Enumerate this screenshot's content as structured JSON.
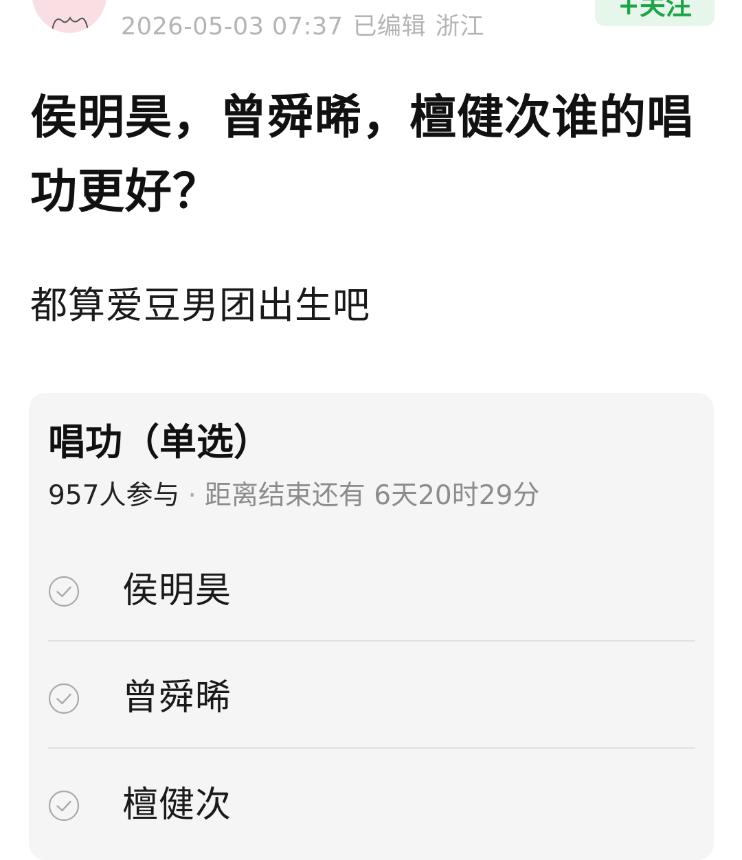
{
  "header": {
    "date": "2026-05-03 07:37",
    "edited": "已编辑",
    "location": "浙江",
    "follow_label": "+关注"
  },
  "post": {
    "title": "侯明昊，曾舜晞，檀健次谁的唱功更好？",
    "body": "都算爱豆男团出生吧"
  },
  "poll": {
    "title": "唱功（单选）",
    "participants": "957人参与",
    "separator": "·",
    "remaining_label": "距离结束还有",
    "remaining_time": "6天20时29分",
    "options": [
      {
        "label": "侯明昊"
      },
      {
        "label": "曾舜晞"
      },
      {
        "label": "檀健次"
      }
    ]
  },
  "colors": {
    "accent_green": "#1fa34a",
    "follow_bg": "#e6f6ea",
    "card_bg": "#f5f5f5",
    "meta_gray": "#b4b4b4"
  },
  "icons": {
    "avatar": "avatar",
    "option_check": "check-circle-icon"
  }
}
